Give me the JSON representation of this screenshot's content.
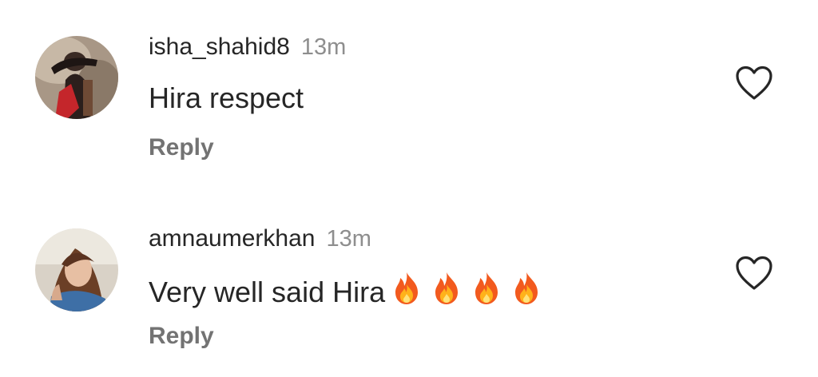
{
  "comments": [
    {
      "username": "isha_shahid8",
      "time": "13m",
      "text": "Hira respect",
      "emojis": [],
      "reply_label": "Reply",
      "like_icon": "heart-outline-icon",
      "avatar": "profile-photo"
    },
    {
      "username": "amnaumerkhan",
      "time": "13m",
      "text": "Very well said Hira",
      "emojis": [
        "fire-emoji",
        "fire-emoji",
        "fire-emoji",
        "fire-emoji"
      ],
      "reply_label": "Reply",
      "like_icon": "heart-outline-icon",
      "avatar": "profile-photo"
    }
  ],
  "colors": {
    "primary_text": "#262626",
    "secondary_text": "#8e8e8e",
    "reply_text": "#737373",
    "background": "#ffffff"
  }
}
